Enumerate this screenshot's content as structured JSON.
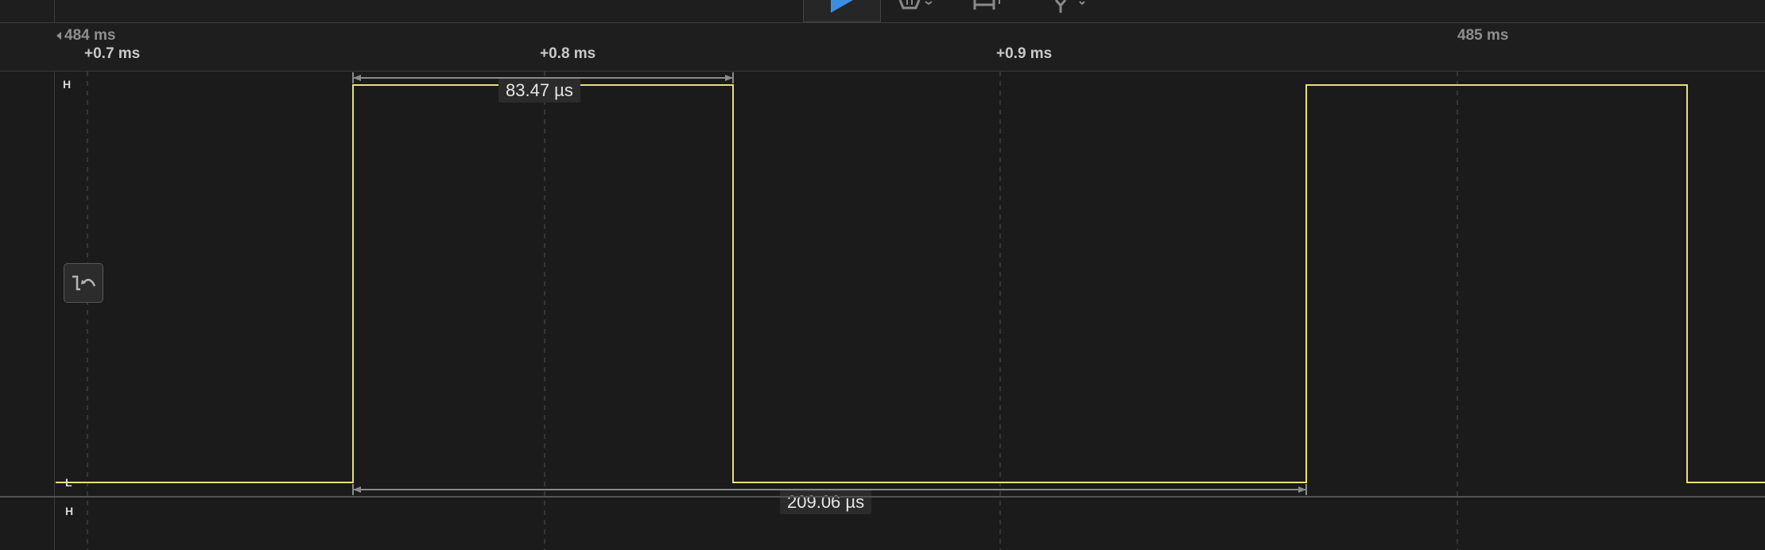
{
  "toolbar": {
    "play_icon": "play-icon",
    "trigger_icon": "trigger-icon",
    "capture_icon": "capture-icon",
    "probe_icon": "probe-icon",
    "accent_color": "#3d8ee0"
  },
  "timeline": {
    "absolute_markers": [
      {
        "label": "484 ms"
      },
      {
        "label": "485 ms"
      }
    ],
    "relative_markers": [
      {
        "label": "+0.7 ms"
      },
      {
        "label": "+0.8 ms"
      },
      {
        "label": "+0.9 ms"
      }
    ]
  },
  "channel": {
    "high_label": "H",
    "low_label": "L",
    "next_channel_high_label": "H",
    "edge_button_icon": "edge-trigger-icon",
    "trace_color": "#e7e07a",
    "levels": [
      "L",
      "H",
      "L",
      "H",
      "L"
    ]
  },
  "measurements": {
    "pulse_width": "83.47 µs",
    "period": "209.06 µs"
  }
}
